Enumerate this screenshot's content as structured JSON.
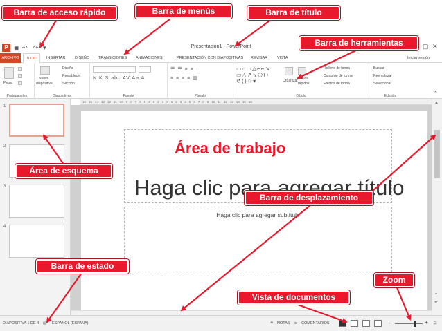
{
  "titlebar": {
    "logo": "P",
    "title": "Presentación1 - PowerPoint",
    "undo_icon": "undo-icon",
    "save_icon": "save-icon",
    "redo_icon": "redo-icon",
    "window_controls": [
      "?",
      "▭",
      "—",
      "▢",
      "✕"
    ]
  },
  "menus": {
    "file": "ARCHIVO",
    "items": [
      "INICIO",
      "INSERTAR",
      "DISEÑO",
      "TRANSICIONES",
      "ANIMACIONES",
      "PRESENTACIÓN CON DIAPOSITIVAS",
      "REVISAR",
      "VISTA"
    ],
    "active": "INICIO",
    "signin": "Iniciar sesión"
  },
  "ribbon": {
    "groups": {
      "clipboard": "Portapapeles",
      "slides": "Diapositivas",
      "font": "Fuente",
      "paragraph": "Párrafo",
      "drawing": "Dibujo",
      "editing": "Edición"
    },
    "paste": "Pegar",
    "new_slide": [
      "Nueva",
      "diapositiva"
    ],
    "layout": "Diseño",
    "reset": "Restablecer",
    "section": "Sección",
    "arrange": "Organizar",
    "quick_styles": [
      "Estilos",
      "rápidos"
    ],
    "shape_fill": "Relleno de forma",
    "shape_outline": "Contorno de forma",
    "shape_effects": "Efectos de forma",
    "find": "Buscar",
    "replace": "Reemplazar",
    "select": "Seleccionar"
  },
  "ruler": {
    "text": "16 · 15 · 14 · 13 · 12 · 11 · 10 · 9 · 8 · 7 · 6 · 5 · 4 · 3 · 2 · 1 · 0 · 1 · 2 · 3 · 4 · 5 · 6 · 7 · 8 · 9 · 10 · 11 · 12 · 13 · 14 · 15 · 16"
  },
  "thumbnails": [
    "1",
    "2",
    "3",
    "4"
  ],
  "slide": {
    "title_placeholder": "Haga clic para agregar título",
    "subtitle_placeholder": "Haga clic para agregar subtítulo"
  },
  "statusbar": {
    "slide_info": "DIAPOSITIVA 1 DE 4",
    "language": "ESPAÑOL (ESPAÑA)",
    "notes": "NOTAS",
    "comments": "COMENTARIOS",
    "zoom_minus": "–",
    "zoom_plus": "+"
  },
  "annotations": {
    "quick_access": "Barra de acceso rápido",
    "menus": "Barra de menús",
    "title": "Barra de título",
    "tools": "Barra de herramientas",
    "workspace": "Área de trabajo",
    "outline": "Área de esquema",
    "scroll": "Barra de desplazamiento",
    "status": "Barra de estado",
    "views": "Vista de documentos",
    "zoom": "Zoom"
  },
  "colors": {
    "accent": "#d24726",
    "callout": "#e8192c"
  }
}
